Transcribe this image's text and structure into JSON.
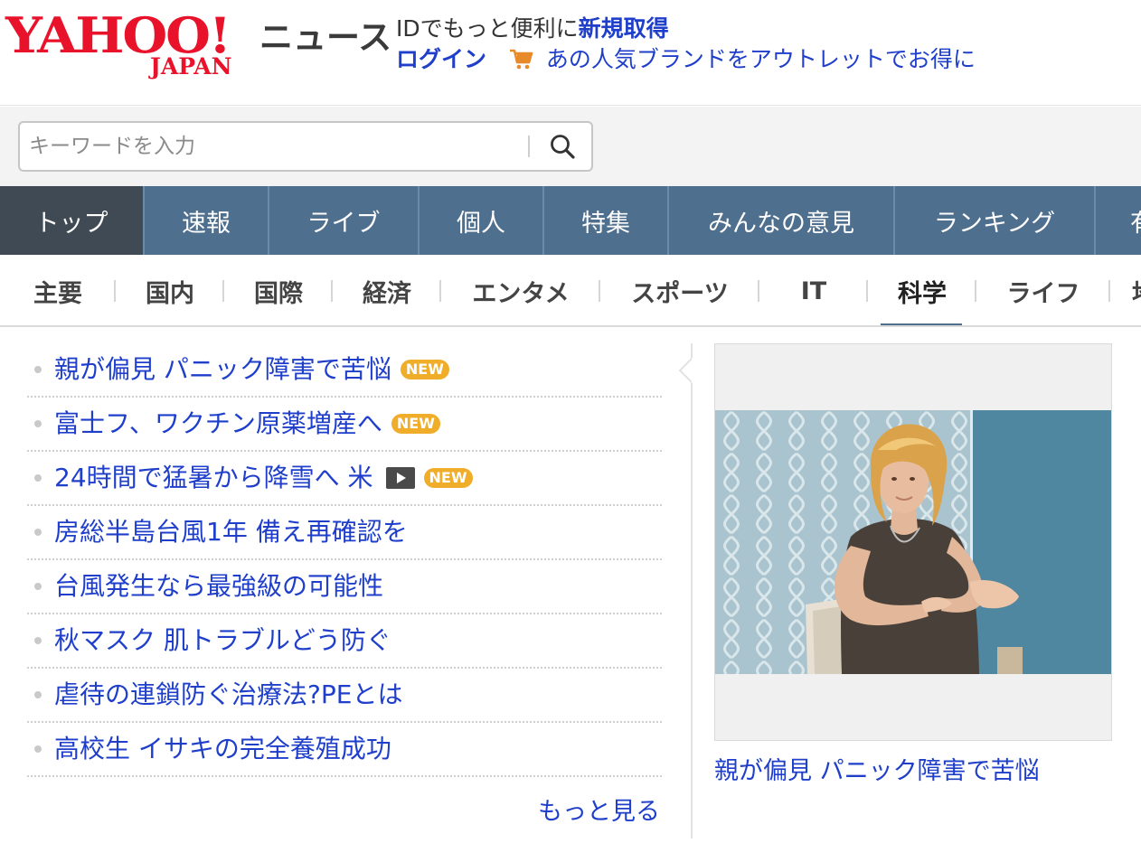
{
  "header": {
    "logo_main": "YAHOO!",
    "logo_sub": "JAPAN",
    "service_name": "ニュース",
    "promo_text": "IDでもっと便利に",
    "promo_link": "新規取得",
    "login_label": "ログイン",
    "shop_link": "あの人気ブランドをアウトレットでお得に",
    "cart_icon": "cart-icon"
  },
  "search": {
    "placeholder": "キーワードを入力",
    "button_icon": "search-icon"
  },
  "global_nav": {
    "items": [
      {
        "label": "トップ",
        "active": true
      },
      {
        "label": "速報"
      },
      {
        "label": "ライブ"
      },
      {
        "label": "個人"
      },
      {
        "label": "特集"
      },
      {
        "label": "みんなの意見"
      },
      {
        "label": "ランキング"
      },
      {
        "label": "有"
      }
    ]
  },
  "category_nav": {
    "items": [
      {
        "label": "主要"
      },
      {
        "label": "国内"
      },
      {
        "label": "国際"
      },
      {
        "label": "経済"
      },
      {
        "label": "エンタメ"
      },
      {
        "label": "スポーツ"
      },
      {
        "label": "IT"
      },
      {
        "label": "科学",
        "active": true
      },
      {
        "label": "ライフ"
      },
      {
        "label": "地"
      }
    ]
  },
  "topics": {
    "items": [
      {
        "title": "親が偏見 パニック障害で苦悩",
        "badge": "NEW"
      },
      {
        "title": "富士フ、ワクチン原薬増産へ",
        "badge": "NEW"
      },
      {
        "title": "24時間で猛暑から降雪へ 米",
        "badge": "NEW",
        "video": true
      },
      {
        "title": "房総半島台風1年 備え再確認を"
      },
      {
        "title": "台風発生なら最強級の可能性"
      },
      {
        "title": "秋マスク 肌トラブルどう防ぐ"
      },
      {
        "title": "虐待の連鎖防ぐ治療法?PEとは"
      },
      {
        "title": "高校生 イサキの完全養殖成功"
      }
    ],
    "more_label": "もっと見る"
  },
  "pickup": {
    "caption": "親が偏見 パニック障害で苦悩"
  },
  "colors": {
    "brand_red": "#e8122b",
    "link_blue": "#1f3fcb",
    "nav_blue": "#4f6f8f",
    "nav_active": "#3f4a54",
    "badge_orange": "#f0ad2a"
  }
}
